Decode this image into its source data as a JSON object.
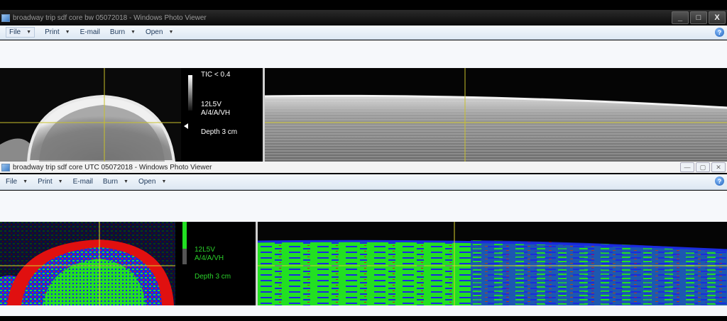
{
  "windows": [
    {
      "title": "broadway trip sdf core bw 05072018 - Windows Photo Viewer",
      "caption_buttons": [
        "_",
        "□",
        "X"
      ],
      "menu": [
        {
          "label": "File",
          "has_arrow": true
        },
        {
          "label": "Print",
          "has_arrow": true
        },
        {
          "label": "E-mail",
          "has_arrow": false
        },
        {
          "label": "Burn",
          "has_arrow": true
        },
        {
          "label": "Open",
          "has_arrow": true
        }
      ],
      "help_icon": "?",
      "image_overlay": {
        "line1": "TIC < 0.4",
        "line2": "12L5V",
        "line3": "A/4/A/VH",
        "depth": "Depth 3 cm"
      },
      "mode": "grayscale"
    },
    {
      "title": "broadway trip sdf core UTC 05072018 - Windows Photo Viewer",
      "caption_buttons": [
        "—",
        "▢",
        "✕"
      ],
      "menu": [
        {
          "label": "File",
          "has_arrow": true
        },
        {
          "label": "Print",
          "has_arrow": true
        },
        {
          "label": "E-mail",
          "has_arrow": false
        },
        {
          "label": "Burn",
          "has_arrow": true
        },
        {
          "label": "Open",
          "has_arrow": true
        }
      ],
      "help_icon": "?",
      "image_overlay": {
        "line2": "12L5V",
        "line3": "A/4/A/VH",
        "depth": "Depth 3 cm"
      },
      "mode": "color-map",
      "colors": {
        "green": "#22e022",
        "blue": "#1a2be0",
        "red": "#e01010",
        "crosshair": "#d8d02a"
      }
    }
  ]
}
